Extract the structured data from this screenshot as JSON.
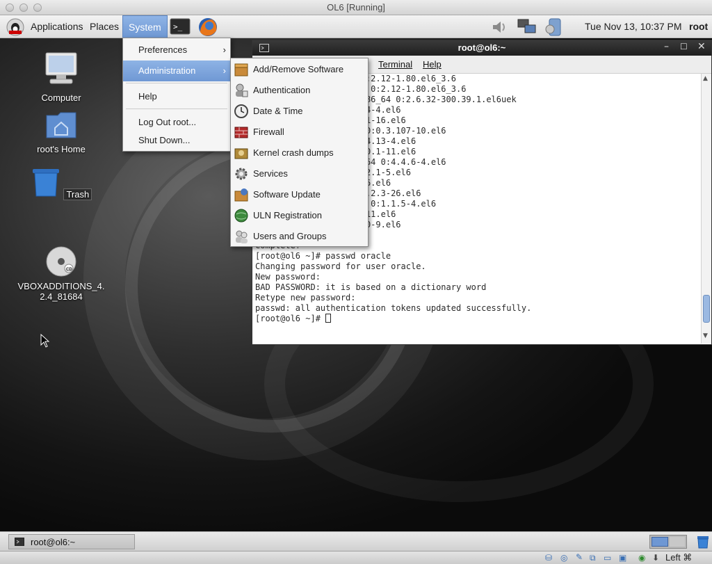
{
  "host": {
    "title": "OL6 [Running]",
    "status_text": "Left ⌘"
  },
  "top_panel": {
    "menus": [
      "Applications",
      "Places",
      "System"
    ],
    "clock": "Tue Nov 13, 10:37 PM",
    "user": "root"
  },
  "desktop": {
    "icons": [
      {
        "label": "Computer",
        "icon": "computer-icon"
      },
      {
        "label": "root's Home",
        "icon": "home-folder-icon"
      },
      {
        "label": "Trash",
        "icon": "trash-icon"
      },
      {
        "label": "VBOXADDITIONS_4.\n2.4_81684",
        "icon": "cd-icon"
      }
    ]
  },
  "system_menu": {
    "items": [
      "Preferences",
      "Administration",
      "Help",
      "Log Out root...",
      "Shut Down..."
    ]
  },
  "admin_menu": {
    "items": [
      "Add/Remove Software",
      "Authentication",
      "Date & Time",
      "Firewall",
      "Kernel crash dumps",
      "Services",
      "Software Update",
      "ULN Registration",
      "Users and Groups"
    ]
  },
  "terminal": {
    "title": "root@ol6:~",
    "menus": [
      "Terminal",
      "Help"
    ],
    "lines": [
      "                     0:2.12-1.80.el6_3.6",
      "                    64 0:2.12-1.80.el6_3.6",
      "                    .x86_64 0:2.6.32-300.39.1.el6uek",
      "                    1.4-4.el6",
      "                    521-16.el6",
      "                    4 0:0.3.107-10.el6",
      "                    1.4.13-4.el6",
      "                    0:0.1-11.el6",
      "                    6_64 0:4.4.6-4.el6",
      "                    0.2.1-5.el6",
      "                    1-6.el6",
      "                    :1.2.3-26.el6",
      "                    64 0:1.1.5-4.el6",
      "                    2-11.el6",
      "                    2.0-9.el6",
      "",
      "Complete!",
      "[root@ol6 ~]# passwd oracle",
      "Changing password for user oracle.",
      "New password:",
      "BAD PASSWORD: it is based on a dictionary word",
      "Retype new password:",
      "passwd: all authentication tokens updated successfully.",
      "[root@ol6 ~]# "
    ]
  },
  "taskbar": {
    "window_button": "root@ol6:~"
  }
}
